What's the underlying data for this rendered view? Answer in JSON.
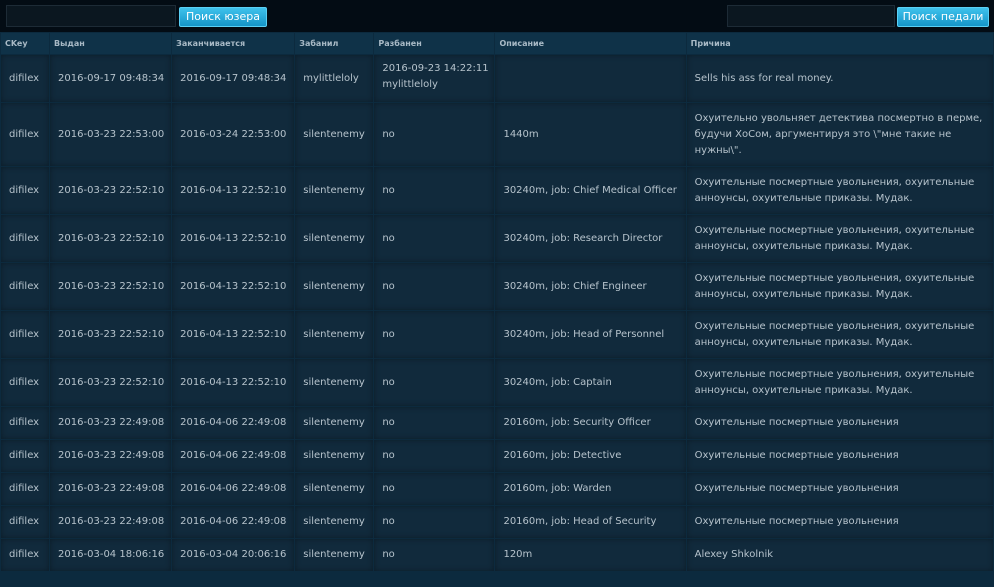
{
  "search": {
    "user_button_label": "Поиск юзера",
    "admin_button_label": "Поиск педали",
    "user_value": "",
    "admin_value": ""
  },
  "table": {
    "headers": [
      "CKey",
      "Выдан",
      "Заканчивается",
      "Забанил",
      "Разбанен",
      "Описание",
      "Причина"
    ],
    "rows": [
      [
        "difilex",
        "2016-09-17 09:48:34",
        "2016-09-17 09:48:34",
        "mylittleloly",
        "2016-09-23 14:22:11 mylittleloly",
        "",
        "Sells his ass for real money."
      ],
      [
        "difilex",
        "2016-03-23 22:53:00",
        "2016-03-24 22:53:00",
        "silentenemy",
        "no",
        "1440m",
        "Охуительно увольняет детектива посмертно в перме, будучи ХоСом, аргументируя это \\\"мне такие не нужны\\\"."
      ],
      [
        "difilex",
        "2016-03-23 22:52:10",
        "2016-04-13 22:52:10",
        "silentenemy",
        "no",
        "30240m, job: Chief Medical Officer",
        "Охуительные посмертные увольнения, охуительные анноунсы, охуительные приказы. Мудак."
      ],
      [
        "difilex",
        "2016-03-23 22:52:10",
        "2016-04-13 22:52:10",
        "silentenemy",
        "no",
        "30240m, job: Research Director",
        "Охуительные посмертные увольнения, охуительные анноунсы, охуительные приказы. Мудак."
      ],
      [
        "difilex",
        "2016-03-23 22:52:10",
        "2016-04-13 22:52:10",
        "silentenemy",
        "no",
        "30240m, job: Chief Engineer",
        "Охуительные посмертные увольнения, охуительные анноунсы, охуительные приказы. Мудак."
      ],
      [
        "difilex",
        "2016-03-23 22:52:10",
        "2016-04-13 22:52:10",
        "silentenemy",
        "no",
        "30240m, job: Head of Personnel",
        "Охуительные посмертные увольнения, охуительные анноунсы, охуительные приказы. Мудак."
      ],
      [
        "difilex",
        "2016-03-23 22:52:10",
        "2016-04-13 22:52:10",
        "silentenemy",
        "no",
        "30240m, job: Captain",
        "Охуительные посмертные увольнения, охуительные анноунсы, охуительные приказы. Мудак."
      ],
      [
        "difilex",
        "2016-03-23 22:49:08",
        "2016-04-06 22:49:08",
        "silentenemy",
        "no",
        "20160m, job: Security Officer",
        "Охуительные посмертные увольнения"
      ],
      [
        "difilex",
        "2016-03-23 22:49:08",
        "2016-04-06 22:49:08",
        "silentenemy",
        "no",
        "20160m, job: Detective",
        "Охуительные посмертные увольнения"
      ],
      [
        "difilex",
        "2016-03-23 22:49:08",
        "2016-04-06 22:49:08",
        "silentenemy",
        "no",
        "20160m, job: Warden",
        "Охуительные посмертные увольнения"
      ],
      [
        "difilex",
        "2016-03-23 22:49:08",
        "2016-04-06 22:49:08",
        "silentenemy",
        "no",
        "20160m, job: Head of Security",
        "Охуительные посмертные увольнения"
      ],
      [
        "difilex",
        "2016-03-04 18:06:16",
        "2016-03-04 20:06:16",
        "silentenemy",
        "no",
        "120m",
        "Alexey Shkolnik"
      ]
    ]
  }
}
